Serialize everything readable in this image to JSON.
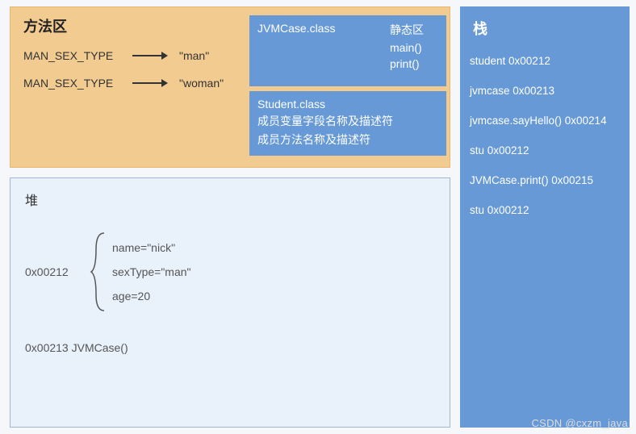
{
  "methodArea": {
    "title": "方法区",
    "constants": [
      {
        "name": "MAN_SEX_TYPE",
        "value": "\"man\""
      },
      {
        "name": "MAN_SEX_TYPE",
        "value": "\"woman\""
      }
    ],
    "jvmClass": {
      "className": "JVMCase.class",
      "staticLabel": "静态区",
      "methods": [
        "main()",
        "print()"
      ]
    },
    "studentClass": {
      "className": "Student.class",
      "line1": "成员变量字段名称及描述符",
      "line2": "成员方法名称及描述符"
    }
  },
  "heap": {
    "title": "堆",
    "object": {
      "address": "0x00212",
      "fields": [
        "name=\"nick\"",
        "sexType=\"man\"",
        "age=20"
      ]
    },
    "instanceLine": "0x00213  JVMCase()"
  },
  "stack": {
    "title": "栈",
    "frames": [
      "student  0x00212",
      "jvmcase  0x00213",
      "jvmcase.sayHello() 0x00214",
      "stu  0x00212",
      "JVMCase.print() 0x00215",
      "stu  0x00212"
    ]
  },
  "watermark": "CSDN @cxzm_java"
}
